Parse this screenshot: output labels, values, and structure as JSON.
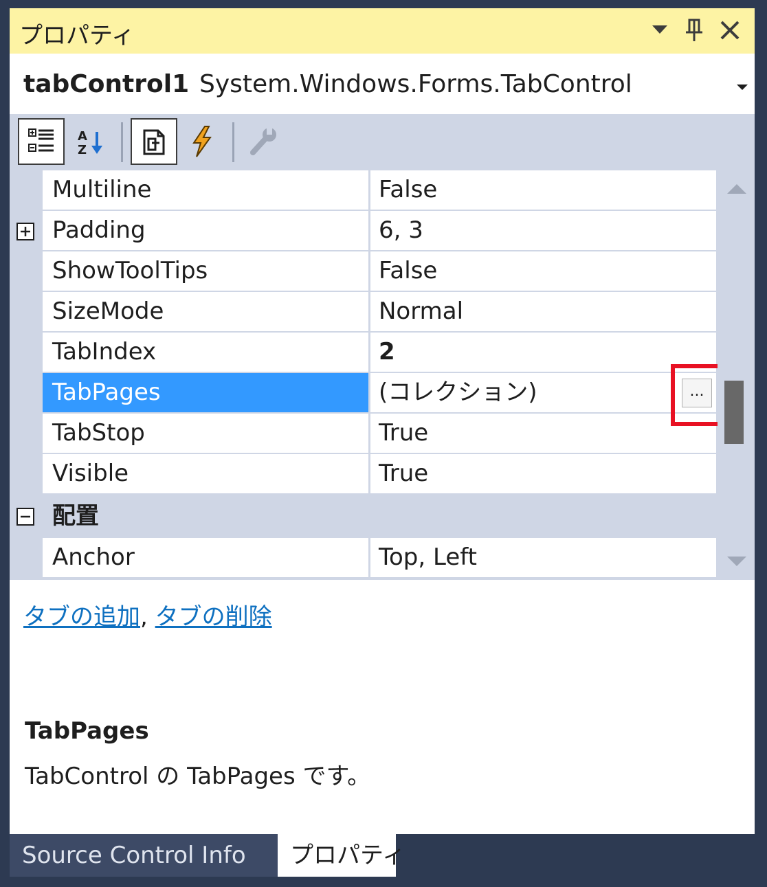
{
  "window": {
    "title": "プロパティ",
    "dropdown_icon": "chevron-down-icon",
    "pin_icon": "pin-icon",
    "close_icon": "close-icon"
  },
  "object_selector": {
    "name": "tabControl1",
    "type": "System.Windows.Forms.TabControl"
  },
  "toolbar": {
    "items": [
      "categorized-icon",
      "alphabetical-icon",
      "properties-icon",
      "events-icon",
      "property-pages-icon"
    ],
    "active": [
      "categorized-icon",
      "properties-icon"
    ]
  },
  "grid": {
    "rows": [
      {
        "name": "Multiline",
        "value": "False"
      },
      {
        "name": "Padding",
        "value": "6, 3",
        "expandable": true
      },
      {
        "name": "ShowToolTips",
        "value": "False"
      },
      {
        "name": "SizeMode",
        "value": "Normal"
      },
      {
        "name": "TabIndex",
        "value": "2",
        "bold": true
      },
      {
        "name": "TabPages",
        "value": "(コレクション)",
        "selected": true,
        "ellipsis": "..."
      },
      {
        "name": "TabStop",
        "value": "True"
      },
      {
        "name": "Visible",
        "value": "True"
      }
    ],
    "category": "配置",
    "after_category": [
      {
        "name": "Anchor",
        "value": "Top, Left"
      }
    ]
  },
  "commands": {
    "add_tab": "タブの追加",
    "separator": ",",
    "remove_tab": "タブの削除"
  },
  "description": {
    "title": "TabPages",
    "text": "TabControl の TabPages です。"
  },
  "bottom_tabs": {
    "source_control": "Source Control Info",
    "properties": "プロパティ"
  },
  "colors": {
    "title_bar": "#fdf3a4",
    "selection": "#3399ff",
    "highlight_box": "#e81123",
    "link": "#0e70c0",
    "frame": "#2d3a52"
  }
}
